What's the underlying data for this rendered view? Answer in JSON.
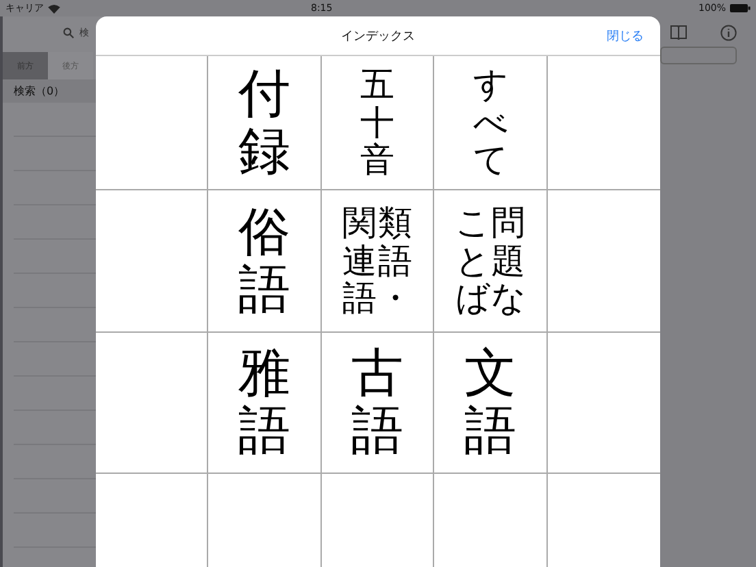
{
  "status_bar": {
    "carrier": "キャリア",
    "time": "8:15",
    "battery": "100%"
  },
  "sidebar": {
    "search": {
      "placeholder": "検"
    },
    "tabs": [
      {
        "label": "前方",
        "selected": true
      },
      {
        "label": "後方",
        "selected": false
      }
    ],
    "result_header": "検索（0）"
  },
  "modal": {
    "title": "インデックス",
    "close": "閉じる",
    "rows": [
      {
        "cells": [
          {
            "kind": "blank"
          },
          {
            "kind": "large",
            "lines": [
              "付録"
            ]
          },
          {
            "kind": "small",
            "lines": [
              "五十音"
            ]
          },
          {
            "kind": "small",
            "lines": [
              "すべて"
            ]
          },
          {
            "kind": "blank"
          }
        ]
      },
      {
        "cells": [
          {
            "kind": "blank"
          },
          {
            "kind": "large",
            "lines": [
              "俗語"
            ]
          },
          {
            "kind": "small",
            "lines": [
              "類語・",
              "関連語"
            ]
          },
          {
            "kind": "small",
            "lines": [
              "問題な",
              "ことば"
            ]
          },
          {
            "kind": "blank"
          }
        ]
      },
      {
        "cells": [
          {
            "kind": "blank"
          },
          {
            "kind": "large",
            "lines": [
              "雅語"
            ]
          },
          {
            "kind": "large",
            "lines": [
              "古語"
            ]
          },
          {
            "kind": "large",
            "lines": [
              "文語"
            ]
          },
          {
            "kind": "blank"
          }
        ]
      },
      {
        "cells": [
          {
            "kind": "blank"
          },
          {
            "kind": "blank"
          },
          {
            "kind": "blank"
          },
          {
            "kind": "blank"
          },
          {
            "kind": "blank"
          }
        ]
      }
    ]
  }
}
